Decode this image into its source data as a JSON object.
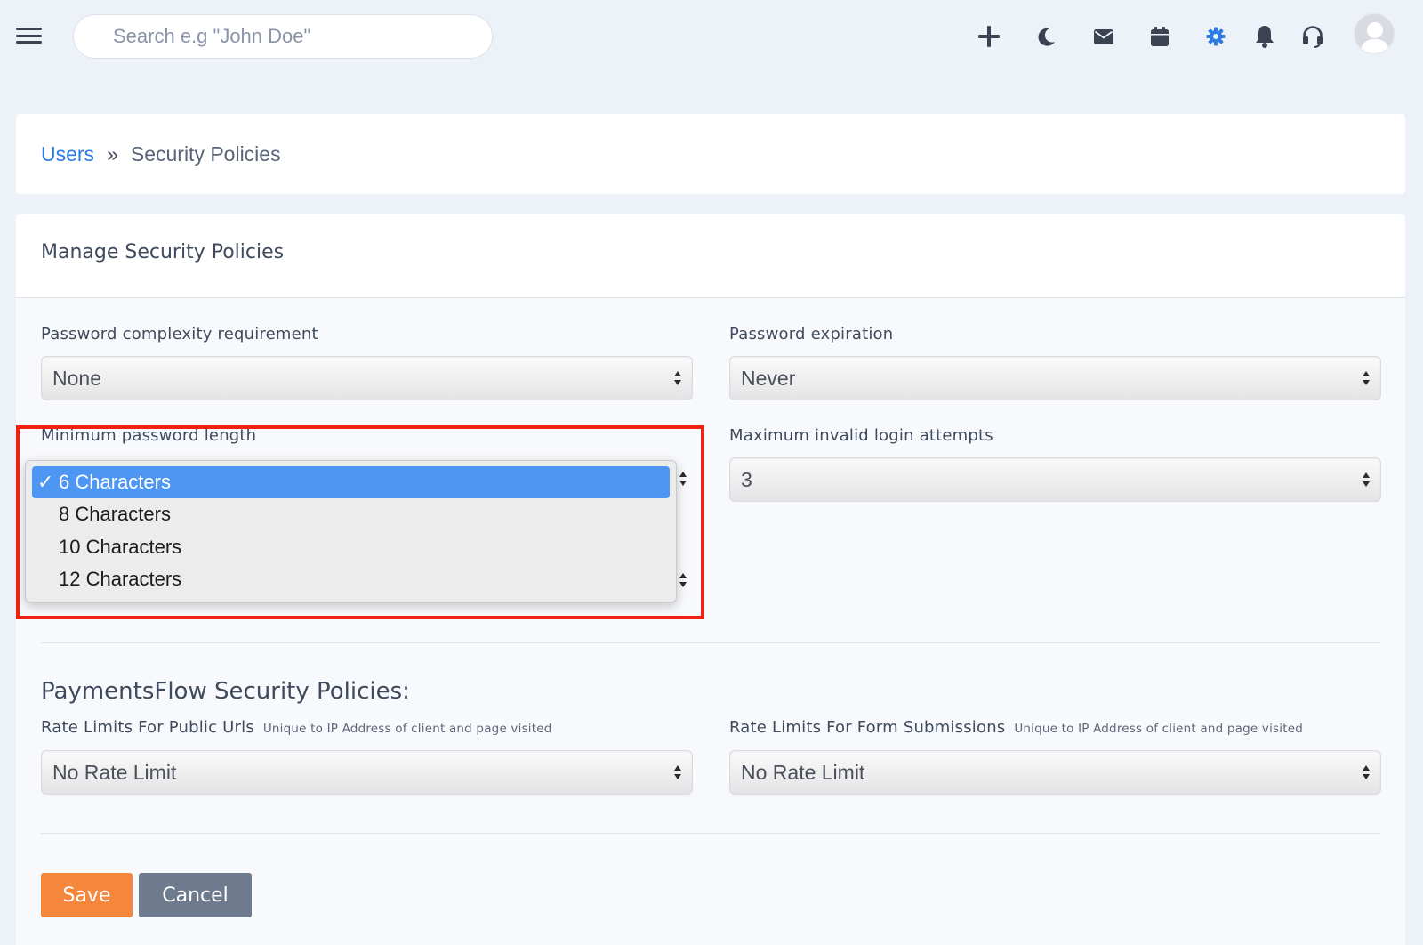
{
  "search": {
    "placeholder": "Search e.g \"John Doe\""
  },
  "header_icons": [
    "plus-icon",
    "moon-icon",
    "mail-icon",
    "calendar-icon",
    "gear-icon",
    "bell-icon",
    "headset-icon",
    "avatar"
  ],
  "colors": {
    "accent": "#2c7be5",
    "save": "#f5873c",
    "cancel": "#6e7a8d",
    "highlight": "#f22010",
    "selected_option": "#4d96f3"
  },
  "breadcrumb": {
    "parent": "Users",
    "separator": "»",
    "current": "Security Policies"
  },
  "card": {
    "title": "Manage Security Policies"
  },
  "fields": {
    "password_complexity": {
      "label": "Password complexity requirement",
      "value": "None"
    },
    "password_expiration": {
      "label": "Password expiration",
      "value": "Never"
    },
    "min_password_length": {
      "label": "Minimum password length",
      "options": [
        "6 Characters",
        "8 Characters",
        "10 Characters",
        "12 Characters"
      ],
      "selected": "6 Characters",
      "check": "✓"
    },
    "max_invalid_logins": {
      "label": "Maximum invalid login attempts",
      "value": "3"
    }
  },
  "payments": {
    "title": "PaymentsFlow Security Policies:",
    "public_urls": {
      "label": "Rate Limits For Public Urls",
      "note": "Unique to IP Address of client and page visited",
      "value": "No Rate Limit"
    },
    "form_submissions": {
      "label": "Rate Limits For Form Submissions",
      "note": "Unique to IP Address of client and page visited",
      "value": "No Rate Limit"
    }
  },
  "buttons": {
    "save": "Save",
    "cancel": "Cancel"
  }
}
